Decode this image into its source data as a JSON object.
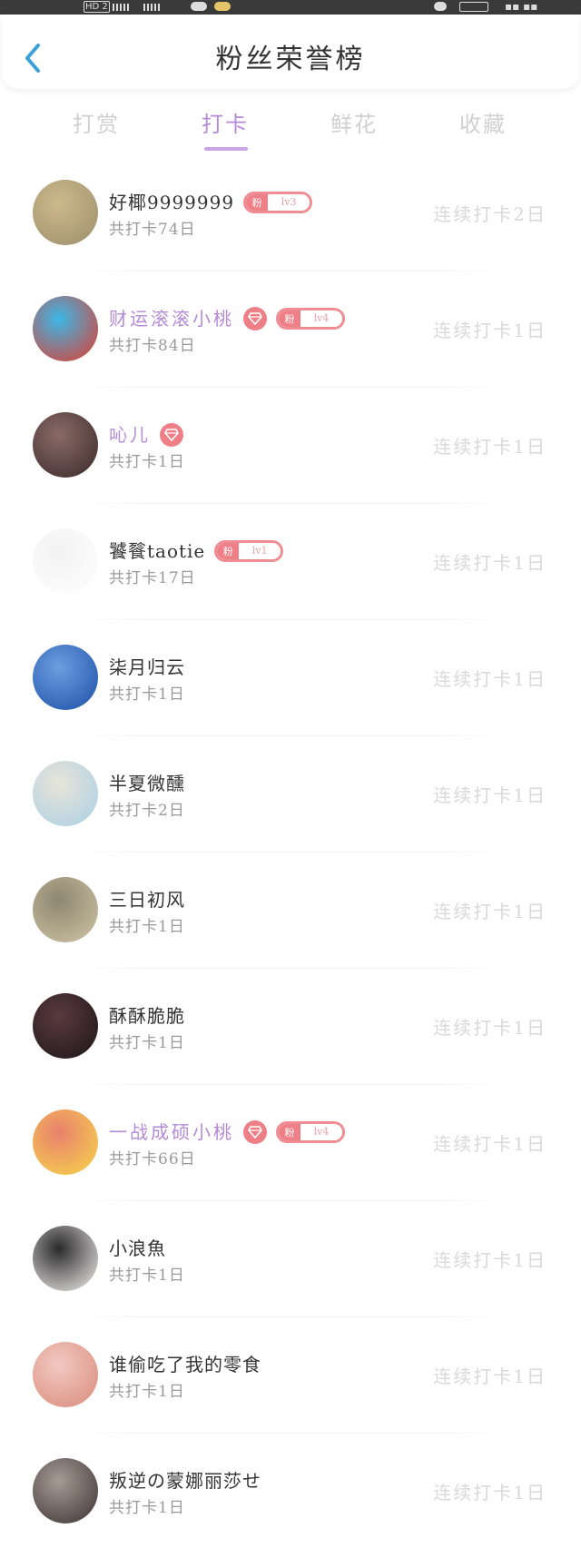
{
  "status_bar": {
    "network_badge": "HD 2"
  },
  "header": {
    "title": "粉丝荣誉榜",
    "back_icon": "chevron-left-icon",
    "accent": "#3aa0d8"
  },
  "tabs": [
    {
      "label": "打赏",
      "active": false
    },
    {
      "label": "打卡",
      "active": true
    },
    {
      "label": "鲜花",
      "active": false
    },
    {
      "label": "收藏",
      "active": false
    }
  ],
  "colors": {
    "active_tab": "#b58ad8",
    "badge": "#ef7f87",
    "vip_name": "#b58ad8",
    "inactive_text": "#d0d0d0"
  },
  "fan_badge_prefix": "粉",
  "list": [
    {
      "name": "好椰9999999",
      "vip": false,
      "gem": false,
      "fan_level": "lv3",
      "total": "共打卡74日",
      "streak": "连续打卡2日",
      "avatar_bg": [
        "#9c8f6e",
        "#cdb98a"
      ]
    },
    {
      "name": "财运滚滚小桃",
      "vip": true,
      "gem": true,
      "fan_level": "lv4",
      "total": "共打卡84日",
      "streak": "连续打卡1日",
      "avatar_bg": [
        "#e23b2a",
        "#3cb7e8"
      ]
    },
    {
      "name": "吣儿",
      "vip": true,
      "gem": true,
      "fan_level": "",
      "total": "共打卡1日",
      "streak": "连续打卡1日",
      "avatar_bg": [
        "#3a2a2a",
        "#8a6a66"
      ]
    },
    {
      "name": "饕餮taotie",
      "vip": false,
      "gem": false,
      "fan_level": "lv1",
      "total": "共打卡17日",
      "streak": "连续打卡1日",
      "avatar_bg": [
        "#ffffff",
        "#f2f2f2"
      ]
    },
    {
      "name": "柒月归云",
      "vip": false,
      "gem": false,
      "fan_level": "",
      "total": "共打卡1日",
      "streak": "连续打卡1日",
      "avatar_bg": [
        "#1d4fa8",
        "#6c9ee0"
      ]
    },
    {
      "name": "半夏微醺",
      "vip": false,
      "gem": false,
      "fan_level": "",
      "total": "共打卡2日",
      "streak": "连续打卡1日",
      "avatar_bg": [
        "#a9cfe6",
        "#e8e4d8"
      ]
    },
    {
      "name": "三日初风",
      "vip": false,
      "gem": false,
      "fan_level": "",
      "total": "共打卡1日",
      "streak": "连续打卡1日",
      "avatar_bg": [
        "#cfc4a6",
        "#8f8670"
      ]
    },
    {
      "name": "酥酥脆脆",
      "vip": false,
      "gem": false,
      "fan_level": "",
      "total": "共打卡1日",
      "streak": "连续打卡1日",
      "avatar_bg": [
        "#1c1618",
        "#5a3a3e"
      ]
    },
    {
      "name": "一战成硕小桃",
      "vip": true,
      "gem": true,
      "fan_level": "lv4",
      "total": "共打卡66日",
      "streak": "连续打卡1日",
      "avatar_bg": [
        "#f6d84a",
        "#e9806d"
      ]
    },
    {
      "name": "小浪魚",
      "vip": false,
      "gem": false,
      "fan_level": "",
      "total": "共打卡1日",
      "streak": "连续打卡1日",
      "avatar_bg": [
        "#f5f1f1",
        "#2a2a2a"
      ]
    },
    {
      "name": "谁偷吃了我的零食",
      "vip": false,
      "gem": false,
      "fan_level": "",
      "total": "共打卡1日",
      "streak": "连续打卡1日",
      "avatar_bg": [
        "#d98a7a",
        "#f2c9c2"
      ]
    },
    {
      "name": "叛逆の蒙娜丽莎せ",
      "vip": false,
      "gem": false,
      "fan_level": "",
      "total": "共打卡1日",
      "streak": "连续打卡1日",
      "avatar_bg": [
        "#3a3232",
        "#a79a94"
      ]
    }
  ]
}
